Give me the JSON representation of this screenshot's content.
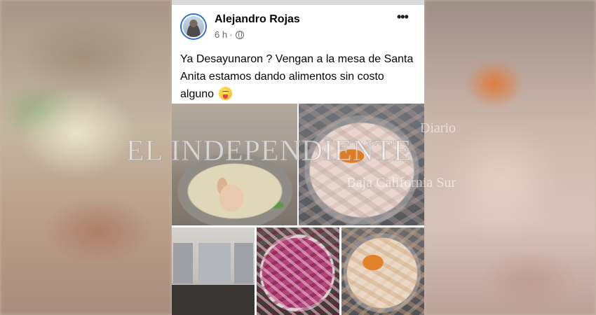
{
  "post": {
    "author": "Alejandro Rojas",
    "time": "6 h",
    "separator": "·",
    "audience_icon": "globe-icon",
    "more_label": "•••",
    "text": "Ya Desayunaron ? Vengan a la mesa de Santa Anita estamos dando alimentos sin costo alguno",
    "emoji": "drooling-face"
  },
  "watermark": {
    "line1": "Diario",
    "line2": "EL INDEPENDIENTE",
    "line3": "Baja California Sur"
  },
  "colors": {
    "card_bg": "#ffffff",
    "author_text": "#050505",
    "meta_text": "#65676b",
    "avatar_ring": "#2d6fd6"
  }
}
